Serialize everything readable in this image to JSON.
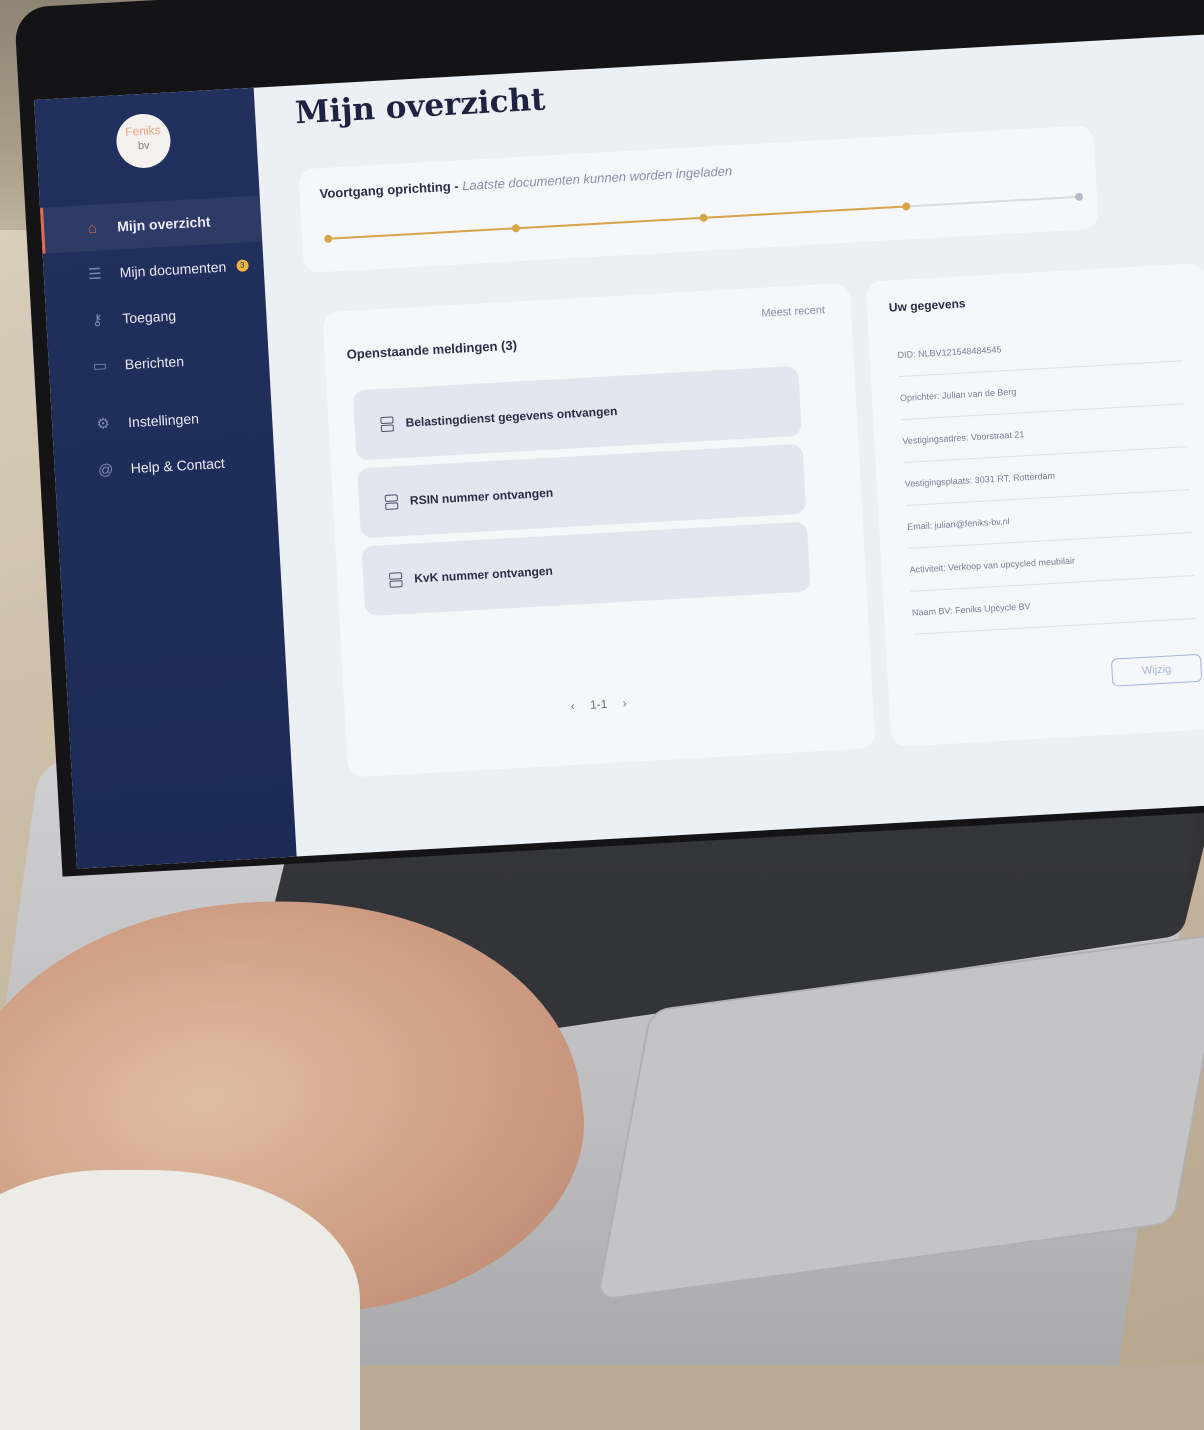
{
  "brand": {
    "name": "Feniks",
    "suffix": "bv"
  },
  "nav": [
    {
      "label": "Mijn overzicht",
      "icon": "home-icon",
      "active": true
    },
    {
      "label": "Mijn documenten",
      "icon": "documents-icon",
      "badge": "3"
    },
    {
      "label": "Toegang",
      "icon": "key-icon"
    },
    {
      "label": "Berichten",
      "icon": "chat-icon"
    },
    {
      "label": "Instellingen",
      "icon": "gear-icon"
    },
    {
      "label": "Help & Contact",
      "icon": "at-icon"
    }
  ],
  "page": {
    "title": "Mijn overzicht"
  },
  "progress": {
    "title": "Voortgang oprichting - ",
    "subtitle": "Laatste documenten kunnen worden ingeladen",
    "completed_fraction": 0.77
  },
  "notifications": {
    "title": "Openstaande meldingen (3)",
    "sort_label": "Meest recent",
    "items": [
      {
        "label": "Belastingdienst gegevens ontvangen"
      },
      {
        "label": "RSIN nummer ontvangen"
      },
      {
        "label": "KvK nummer ontvangen"
      }
    ],
    "pagination": {
      "prev": "‹",
      "current": "1-1",
      "next": "›"
    }
  },
  "details": {
    "title": "Uw gegevens",
    "fields": [
      "DID: NLBV121548484545",
      "Oprichter: Julian van de Berg",
      "Vestigingsadres: Voorstraat 21",
      "Vestigingsplaats: 3031 RT, Rotterdam",
      "Email: julian@feniks-bv.nl",
      "Activiteit: Verkoop van upcycled meubilair",
      "Naam BV: Feniks Upcycle BV"
    ],
    "edit_label": "Wijzig"
  },
  "colors": {
    "sidebar": "#22305e",
    "accent": "#e26a4d",
    "progress": "#d7a64b",
    "badge": "#f2b33d"
  }
}
